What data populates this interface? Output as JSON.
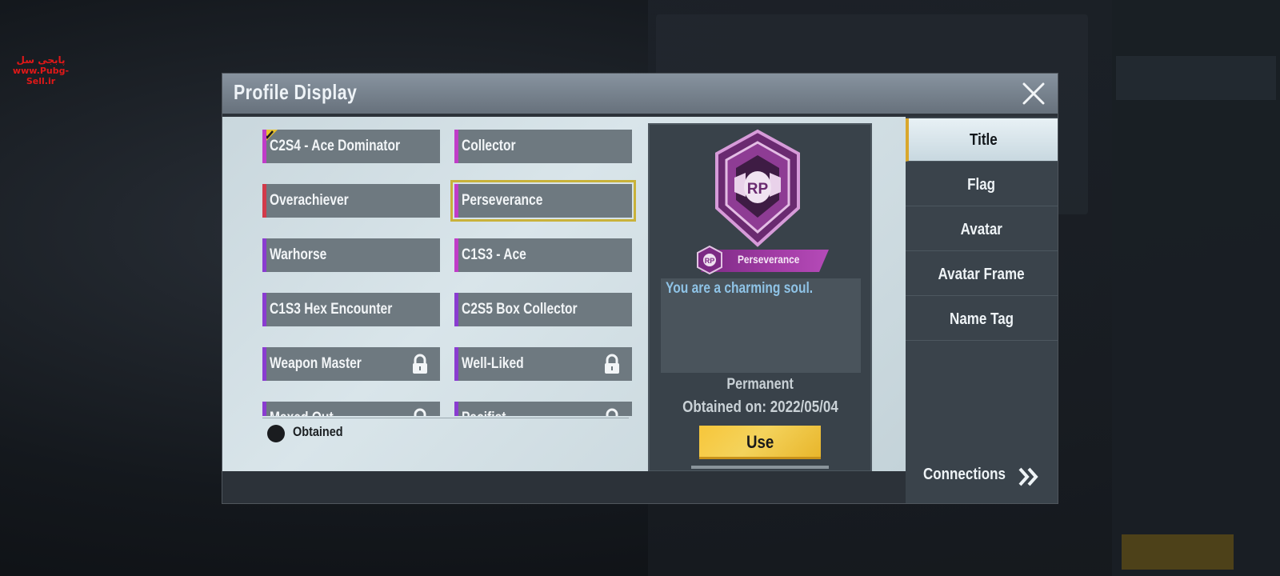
{
  "watermark": {
    "text_fa": "پابجی سل",
    "url": "www.Pubg-Sell.ir"
  },
  "dialog": {
    "title": "Profile Display",
    "close_icon": "close-icon"
  },
  "titles": [
    {
      "label": "C2S4 - Ace Dominator",
      "accent": "#c03cc8",
      "equipped": true,
      "locked": false
    },
    {
      "label": "Collector",
      "accent": "#c03cc8",
      "equipped": false,
      "locked": false
    },
    {
      "label": "Overachiever",
      "accent": "#d23a4a",
      "equipped": false,
      "locked": false
    },
    {
      "label": "Perseverance",
      "accent": "#c03cc8",
      "equipped": false,
      "locked": false,
      "selected": true
    },
    {
      "label": "Warhorse",
      "accent": "#8a3cd0",
      "equipped": false,
      "locked": false
    },
    {
      "label": "C1S3 - Ace",
      "accent": "#c03cc8",
      "equipped": false,
      "locked": false
    },
    {
      "label": "C1S3 Hex Encounter",
      "accent": "#8a3cd0",
      "equipped": false,
      "locked": false
    },
    {
      "label": "C2S5 Box Collector",
      "accent": "#8a3cd0",
      "equipped": false,
      "locked": false
    },
    {
      "label": "Weapon Master",
      "accent": "#8a3cd0",
      "equipped": false,
      "locked": true
    },
    {
      "label": "Well-Liked",
      "accent": "#8a3cd0",
      "equipped": false,
      "locked": true
    },
    {
      "label": "Maxed Out",
      "accent": "#8a3cd0",
      "equipped": false,
      "locked": true
    },
    {
      "label": "Pacifist",
      "accent": "#8a3cd0",
      "equipped": false,
      "locked": true
    }
  ],
  "legend": {
    "label": "Obtained"
  },
  "preview": {
    "badge_text": "RP",
    "title_name": "Perseverance",
    "description": "You are a charming soul.",
    "duration": "Permanent",
    "obtained": "Obtained on: 2022/05/04",
    "use_label": "Use"
  },
  "tabs": [
    {
      "label": "Title",
      "active": true
    },
    {
      "label": "Flag",
      "active": false
    },
    {
      "label": "Avatar",
      "active": false
    },
    {
      "label": "Avatar Frame",
      "active": false
    },
    {
      "label": "Name Tag",
      "active": false
    }
  ],
  "connections": {
    "label": "Connections"
  }
}
